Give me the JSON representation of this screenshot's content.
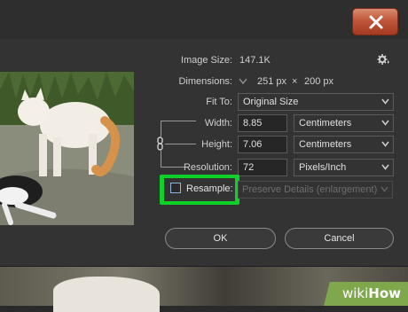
{
  "dialog": {
    "image_size_label": "Image Size:",
    "image_size_value": "147.1K",
    "dimensions_label": "Dimensions:",
    "dimensions_width": "251 px",
    "dimensions_times": "×",
    "dimensions_height": "200 px",
    "fit_to_label": "Fit To:",
    "fit_to_value": "Original Size",
    "width_label": "Width:",
    "width_value": "8.85",
    "width_unit": "Centimeters",
    "height_label": "Height:",
    "height_value": "7.06",
    "height_unit": "Centimeters",
    "resolution_label": "Resolution:",
    "resolution_value": "72",
    "resolution_unit": "Pixels/Inch",
    "resample_label": "Resample:",
    "resample_checked": false,
    "resample_method": "Preserve Details (enlargement)",
    "ok_label": "OK",
    "cancel_label": "Cancel"
  },
  "icons": {
    "close": "close-icon",
    "gear": "gear-icon",
    "chain": "chain-link-icon",
    "dropdown": "chevron-down-icon"
  },
  "colors": {
    "highlight": "#10d02a",
    "close_button": "#c0573a",
    "dialog_bg": "#333333",
    "watermark": "#7fa84c"
  },
  "watermark": {
    "text_a": "wiki",
    "text_b": "How"
  }
}
